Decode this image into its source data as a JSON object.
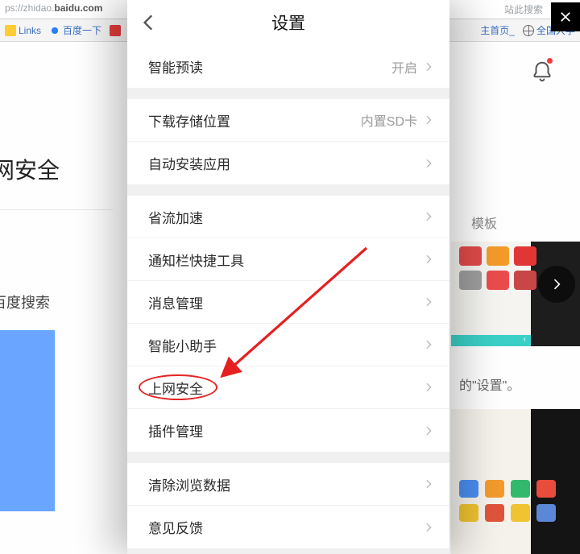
{
  "background": {
    "url_prefix": "ps://zhidao.",
    "url_domain": "baidu.com",
    "search_hint": "站此搜索",
    "bookmarks": {
      "links": "Links",
      "baidu": "百度一下",
      "home": "主首页_",
      "univ": "全国大学"
    },
    "big_title": "网安全",
    "template_label": "模板",
    "baidu_search_text": "百度搜索",
    "setting_sentence": "的\"设置\"。"
  },
  "close_label": "close",
  "settings": {
    "title": "设置",
    "rows": {
      "smart_preload": {
        "label": "智能预读",
        "value": "开启"
      },
      "download_location": {
        "label": "下载存储位置",
        "value": "内置SD卡"
      },
      "auto_install": {
        "label": "自动安装应用"
      },
      "data_saver": {
        "label": "省流加速"
      },
      "notif_shortcut": {
        "label": "通知栏快捷工具"
      },
      "message_mgmt": {
        "label": "消息管理"
      },
      "smart_assistant": {
        "label": "智能小助手"
      },
      "web_security": {
        "label": "上网安全"
      },
      "plugin_mgmt": {
        "label": "插件管理"
      },
      "clear_data": {
        "label": "清除浏览数据"
      },
      "feedback": {
        "label": "意见反馈"
      }
    }
  }
}
